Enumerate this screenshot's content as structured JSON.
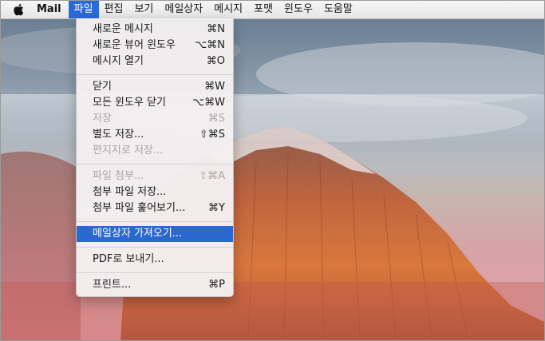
{
  "menubar": {
    "apple_icon": "apple-logo-icon",
    "app_name": "Mail",
    "menus": [
      "파일",
      "편집",
      "보기",
      "메일상자",
      "메시지",
      "포맷",
      "윈도우",
      "도움말"
    ],
    "active_menu": "파일"
  },
  "file_menu": {
    "items": [
      {
        "label": "새로운 메시지",
        "shortcut": "⌘N",
        "enabled": true
      },
      {
        "label": "새로운 뷰어 윈도우",
        "shortcut": "⌥⌘N",
        "enabled": true
      },
      {
        "label": "메시지 열기",
        "shortcut": "⌘O",
        "enabled": true
      },
      {
        "label": "닫기",
        "shortcut": "⌘W",
        "enabled": true
      },
      {
        "label": "모든 윈도우 닫기",
        "shortcut": "⌥⌘W",
        "enabled": true
      },
      {
        "label": "저장",
        "shortcut": "⌘S",
        "enabled": false
      },
      {
        "label": "별도 저장...",
        "shortcut": "⇧⌘S",
        "enabled": true
      },
      {
        "label": "편지지로 저장...",
        "shortcut": "",
        "enabled": false
      },
      {
        "label": "파일 첨부...",
        "shortcut": "⇧⌘A",
        "enabled": false
      },
      {
        "label": "첨부 파일 저장...",
        "shortcut": "",
        "enabled": true
      },
      {
        "label": "첨부 파일 훑어보기...",
        "shortcut": "⌘Y",
        "enabled": true
      },
      {
        "label": "메일상자 가져오기...",
        "shortcut": "",
        "enabled": true,
        "highlighted": true
      },
      {
        "label": "PDF로 보내기...",
        "shortcut": "",
        "enabled": true
      },
      {
        "label": "프린트...",
        "shortcut": "⌘P",
        "enabled": true
      }
    ]
  },
  "colors": {
    "highlight": "#2a68d0",
    "disabled_text": "#a9a6a7"
  }
}
